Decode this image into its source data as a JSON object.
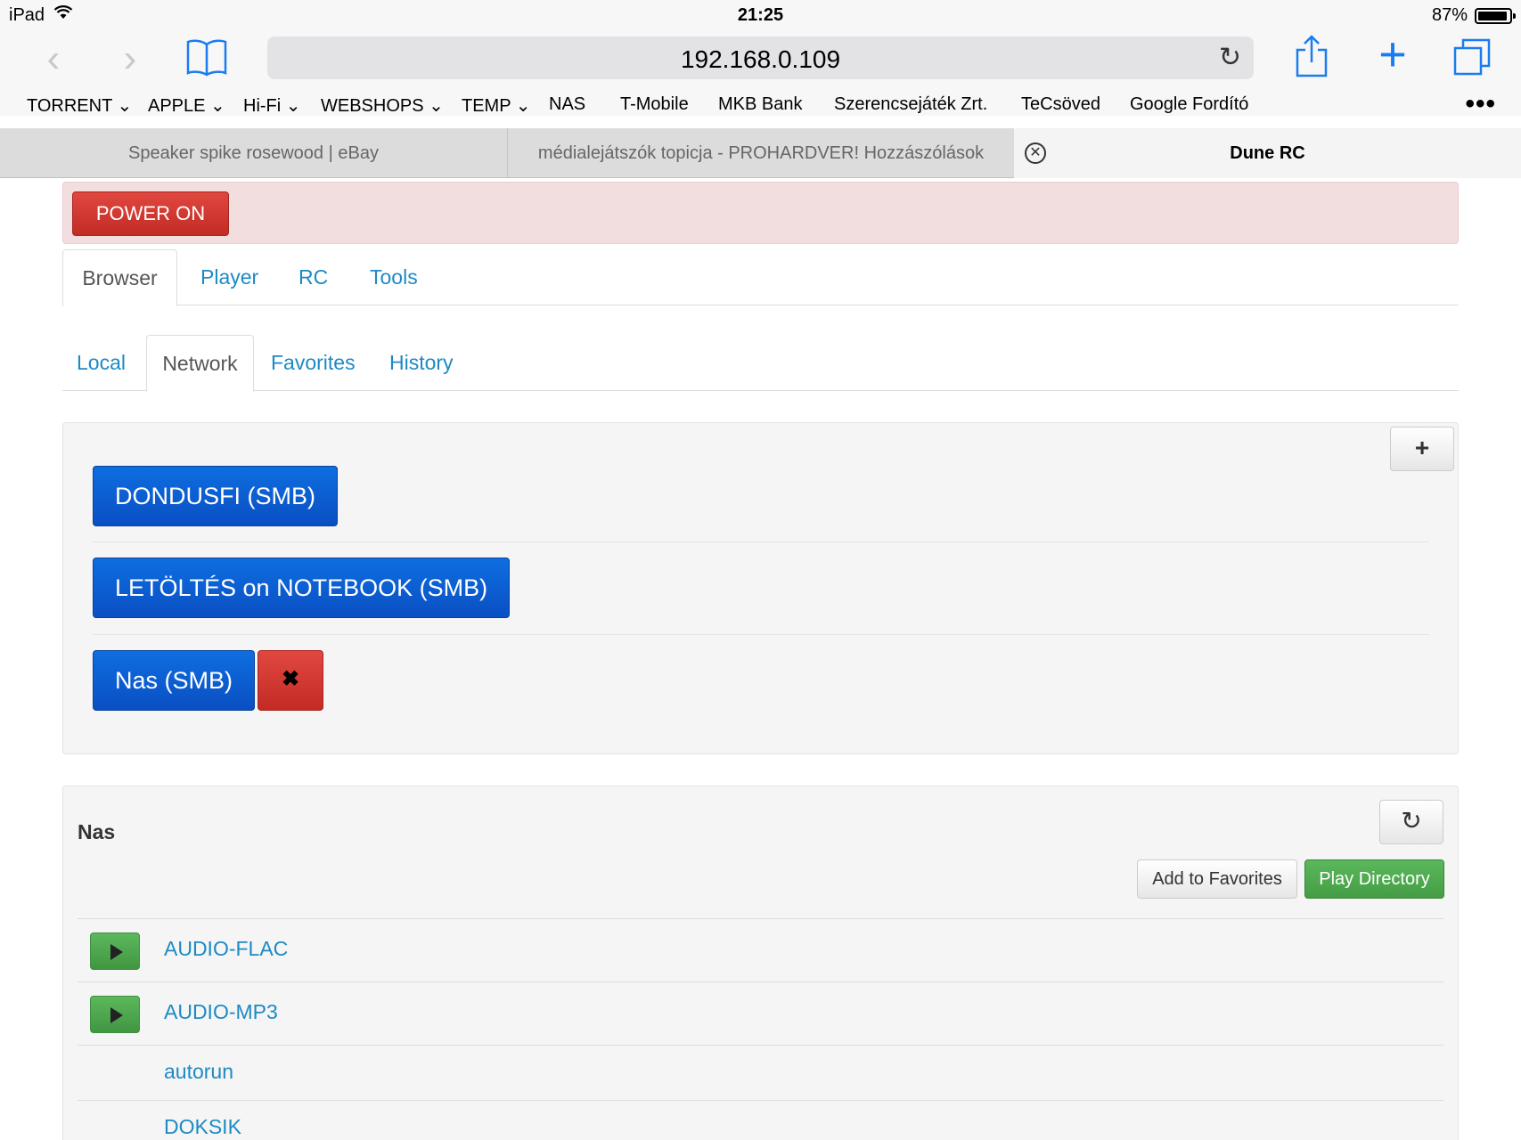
{
  "status_bar": {
    "device": "iPad",
    "time": "21:25",
    "battery": "87%",
    "battery_level": 0.87
  },
  "toolbar": {
    "url": "192.168.0.109",
    "icons": [
      "back-icon",
      "forward-icon",
      "bookmarks-icon",
      "reload-icon",
      "share-icon",
      "new-tab-icon",
      "tabs-icon"
    ]
  },
  "bookmarks": [
    {
      "label": "TORRENT",
      "folder": true
    },
    {
      "label": "APPLE",
      "folder": true
    },
    {
      "label": "Hi-Fi",
      "folder": true
    },
    {
      "label": "WEBSHOPS",
      "folder": true
    },
    {
      "label": "TEMP",
      "folder": true
    },
    {
      "label": "NAS",
      "folder": false
    },
    {
      "label": "T-Mobile",
      "folder": false
    },
    {
      "label": "MKB Bank",
      "folder": false
    },
    {
      "label": "Szerencsejáték Zrt.",
      "folder": false
    },
    {
      "label": "TeCsöved",
      "folder": false
    },
    {
      "label": "Google Fordító",
      "folder": false
    }
  ],
  "browser_tabs": [
    {
      "title": "Speaker spike rosewood | eBay",
      "active": false
    },
    {
      "title": "médialejátszók topicja - PROHARDVER! Hozzászólások",
      "active": false
    },
    {
      "title": "Dune RC",
      "active": true
    }
  ],
  "page": {
    "power_button": "POWER ON",
    "main_tabs": [
      {
        "label": "Browser",
        "active": true
      },
      {
        "label": "Player",
        "active": false
      },
      {
        "label": "RC",
        "active": false
      },
      {
        "label": "Tools",
        "active": false
      }
    ],
    "sub_tabs": [
      {
        "label": "Local",
        "active": false
      },
      {
        "label": "Network",
        "active": true
      },
      {
        "label": "Favorites",
        "active": false
      },
      {
        "label": "History",
        "active": false
      }
    ],
    "add_share_button": "+",
    "shares": [
      {
        "label": "DONDUSFI (SMB)"
      },
      {
        "label": "LETÖLTÉS on NOTEBOOK (SMB)"
      },
      {
        "label": "Nas (SMB)",
        "delete_label": "✖"
      }
    ],
    "directory": {
      "title": "Nas",
      "refresh_icon": "refresh-icon",
      "add_favorites": "Add to Favorites",
      "play_directory": "Play Directory",
      "items": [
        {
          "name": "AUDIO-FLAC",
          "playable": true
        },
        {
          "name": "AUDIO-MP3",
          "playable": true
        },
        {
          "name": "autorun",
          "playable": false
        },
        {
          "name": "DOKSIK",
          "playable": false
        }
      ]
    }
  },
  "colors": {
    "ios_blue": "#1a7cf0",
    "link_blue": "#1d8ac4",
    "danger_red": "#c9302c",
    "primary_blue": "#0a5fd3",
    "success_green": "#5cb85c",
    "alert_pink": "#f2dede"
  }
}
